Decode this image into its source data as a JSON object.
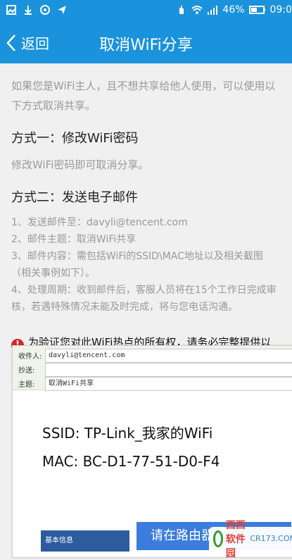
{
  "statusbar": {
    "battery": "46%",
    "time": "09:0",
    "left_icons": [
      "image-icon",
      "download-icon",
      "app-icon",
      "send-icon"
    ],
    "right_icons": [
      "hand-icon",
      "wifi-icon",
      "signal-icon",
      "battery-icon"
    ]
  },
  "nav": {
    "back_label": "返回",
    "title": "取消WiFi分享"
  },
  "content": {
    "intro": "如果您是WiFi主人，且不想共享给他人使用，可以使用以下方式取消共享。",
    "method1_title": "方式一：修改WiFi密码",
    "method1_desc": "修改WiFi密码即可取消分享。",
    "method2_title": "方式二：发送电子邮件",
    "steps": [
      "1、发送邮件至：davyli@tencent.com",
      "2、邮件主题：取消WiFi共享",
      "3、邮件内容：需包括WiFi的SSID\\MAC地址以及相关截图（相关事例如下）。",
      "4、处理周期：收到邮件后，客服人员将在15个工作日完成审核，若遇特殊情况未能及时完成，将与您电话沟通。"
    ],
    "warning": "为验证您对此WiFi热点的所有权，请务必完整提供以上信息，否则将不能取消分享，敬请理解！"
  },
  "example": {
    "to_label": "收件人:",
    "to_value": "davyli@tencent.com",
    "cc_label": "抄送:",
    "cc_value": "",
    "subject_label": "主题:",
    "subject_value": "取消WiFi共享",
    "ssid": "SSID: TP-Link_我家的WiFi",
    "mac": "MAC: BC-D1-77-51-D0-F4",
    "router_button": "请在路由器设置页截图",
    "side_text": "基本信息"
  },
  "watermark": {
    "brand": "西西软件园",
    "domain": "CR173.COM"
  },
  "colors": {
    "brand_blue": "#1a92dc",
    "warning_red": "#e02222"
  }
}
